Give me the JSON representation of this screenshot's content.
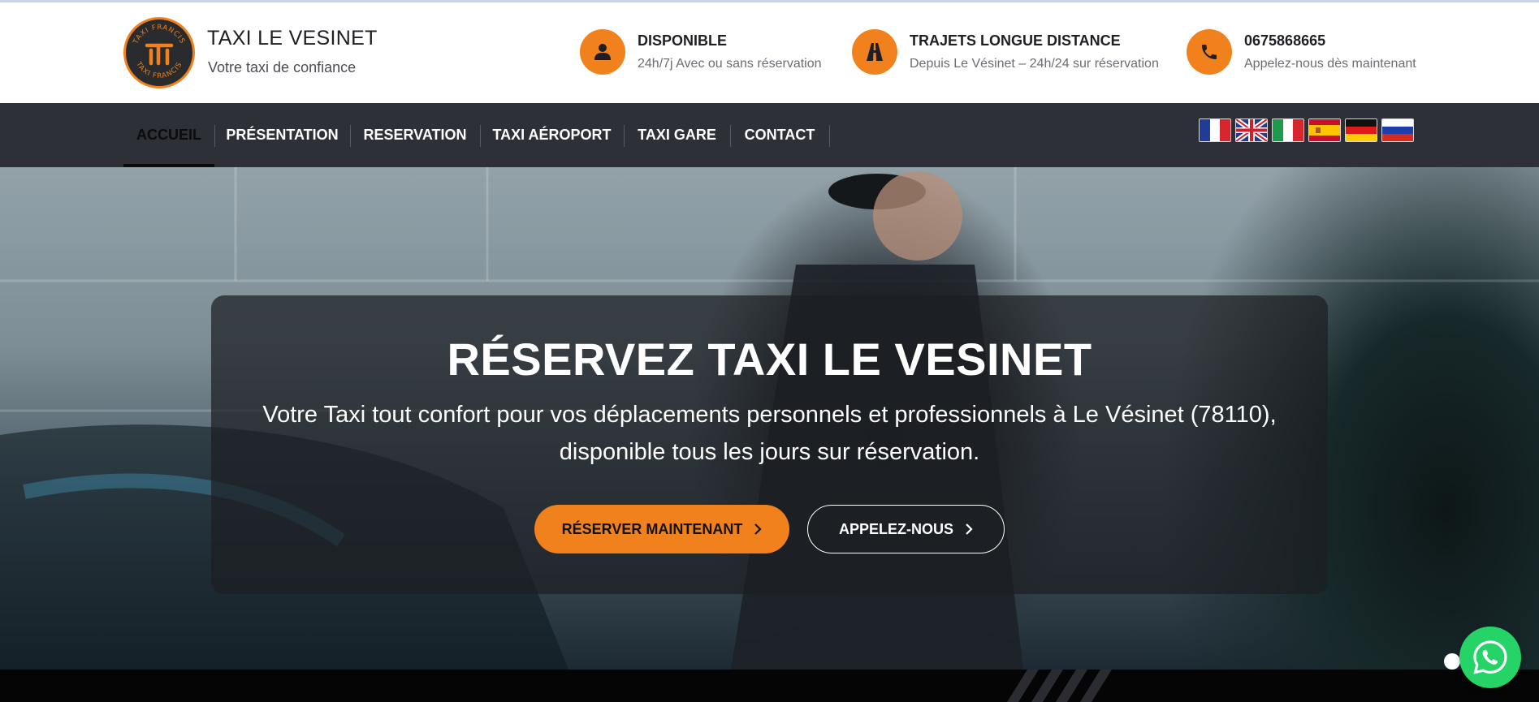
{
  "brand": {
    "title": "TAXI LE VESINET",
    "subtitle": "Votre taxi de confiance",
    "logo_ring_text": "TAXI FRANCIS",
    "logo_icon": "taxi-francis-logo"
  },
  "info": [
    {
      "icon": "user-icon",
      "title": "DISPONIBLE",
      "text": "24h/7j Avec ou sans réservation"
    },
    {
      "icon": "road-icon",
      "title": "TRAJETS LONGUE DISTANCE",
      "text": "Depuis Le Vésinet – 24h/24 sur réservation"
    },
    {
      "icon": "phone-icon",
      "title": "0675868665",
      "text": "Appelez-nous dès maintenant"
    }
  ],
  "nav": {
    "items": [
      "ACCUEIL",
      "PRÉSENTATION",
      "RESERVATION",
      "TAXI AÉROPORT",
      "TAXI GARE",
      "CONTACT"
    ],
    "active": "ACCUEIL",
    "languages": [
      "french-flag",
      "english-flag",
      "italian-flag",
      "spanish-flag",
      "german-flag",
      "russian-flag"
    ]
  },
  "hero": {
    "title": "RÉSERVEZ TAXI LE VESINET",
    "text": "Votre Taxi tout confort pour vos déplacements personnels et professionnels à Le Vésinet (78110), disponible tous les jours sur réservation.",
    "primary_button": "RÉSERVER MAINTENANT",
    "secondary_button": "APPELEZ-NOUS"
  },
  "widgets": {
    "whatsapp_icon": "whatsapp-icon"
  },
  "colors": {
    "accent": "#f0811d",
    "nav_bg": "#2e3037",
    "whatsapp": "#25d366"
  }
}
